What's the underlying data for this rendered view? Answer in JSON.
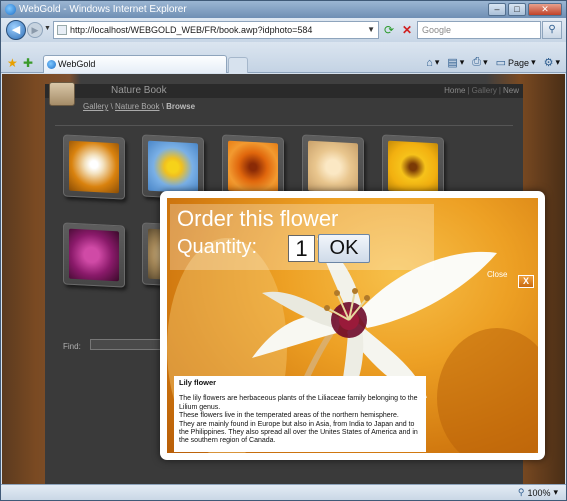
{
  "window": {
    "title": "WebGold - Windows Internet Explorer"
  },
  "address": {
    "url": "http://localhost/WEBGOLD_WEB/FR/book.awp?idphoto=584",
    "search_placeholder": "Google"
  },
  "tabs": [
    {
      "label": "WebGold"
    }
  ],
  "toolbar": {
    "page_label": "Page"
  },
  "site": {
    "title": "Nature Book",
    "nav": [
      "Home",
      "Gallery",
      "New"
    ],
    "breadcrumb": [
      "Gallery",
      "Nature Book"
    ],
    "breadcrumb_current": "Browse",
    "find_label": "Find:"
  },
  "modal": {
    "heading": "Order this flower",
    "quantity_label": "Quantity:",
    "quantity_value": "1",
    "ok_label": "OK",
    "close_label": "Close",
    "close_x": "X",
    "flower_name": "Lily flower",
    "description": [
      "The lily flowers are herbaceous plants of the Liliaceae family belonging to the Lilium genus.",
      "These flowers live in the temperated areas of the northern hemisphere.",
      "They are mainly found in Europe but also in Asia, from India to Japan and to the Philippines. They also spread all over the Unites States of America and in the southern region of Canada."
    ]
  },
  "status": {
    "zoom": "100%"
  },
  "colors": {
    "accent": "#e8961e",
    "page_bg": "#3a3a3a",
    "chrome": "#d7e2ee"
  }
}
